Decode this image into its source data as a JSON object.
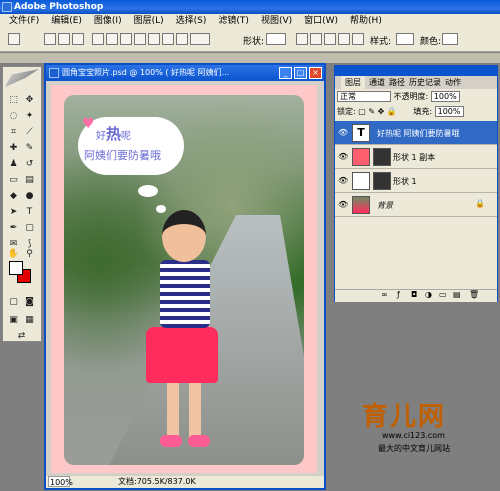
{
  "app": {
    "title": "Adobe Photoshop"
  },
  "menu": [
    "文件(F)",
    "编辑(E)",
    "图像(I)",
    "图层(L)",
    "选择(S)",
    "滤镜(T)",
    "视图(V)",
    "窗口(W)",
    "帮助(H)"
  ],
  "options_bar": {
    "shape_label": "形状:",
    "style_label": "样式:",
    "color_label": "颜色:"
  },
  "document": {
    "title": "圆角宝宝照片.psd @ 100% (    好热呢 阿姨们...",
    "zoom": "100%",
    "doc_size": "文档:705.5K/837.0K",
    "bubble_line1_a": "好",
    "bubble_line1_b": "热",
    "bubble_line1_c": "呢",
    "bubble_line2": "阿姨们要防暑哦"
  },
  "layers_panel": {
    "tabs": [
      "图层",
      "通道",
      "路径",
      "历史记录",
      "动作"
    ],
    "blend_mode": "正常",
    "opacity_label": "不透明度:",
    "opacity": "100%",
    "lock_label": "锁定:",
    "fill_label": "填充:",
    "fill": "100%",
    "layers": [
      {
        "name": "好热呢 阿姨们要防暑哦",
        "kind": "text",
        "selected": true
      },
      {
        "name": "形状 1 副本",
        "kind": "shape",
        "selected": false
      },
      {
        "name": "形状 1",
        "kind": "shape",
        "selected": false
      },
      {
        "name": "背景",
        "kind": "background",
        "selected": false
      }
    ]
  },
  "watermark": {
    "logo": "育儿网",
    "url": "www.ci123.com",
    "slogan": "最大的中文育儿网站"
  },
  "colors": {
    "foreground": "#ffffff",
    "background": "#e00000"
  }
}
